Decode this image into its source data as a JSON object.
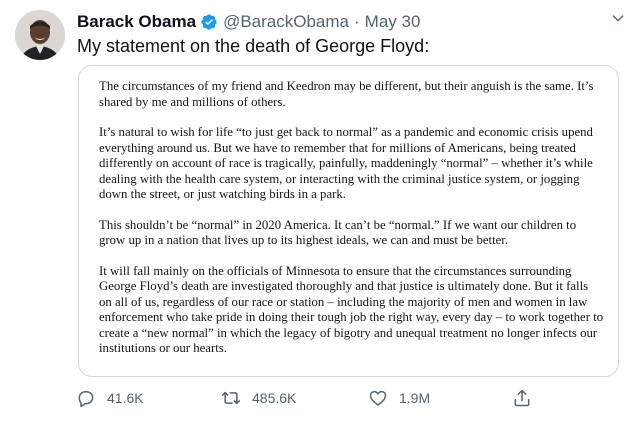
{
  "tweet": {
    "author_name": "Barack Obama",
    "author_handle": "@BarackObama",
    "separator": "·",
    "date": "May 30",
    "text": "My statement on the death of George Floyd:",
    "verified": true
  },
  "statement": {
    "paragraphs": [
      "The circumstances of my friend and Keedron may be different, but their anguish is the same. It’s shared by me and millions of others.",
      "It’s natural to wish for life “to just get back to normal” as a pandemic and economic crisis upend everything around us. But we have to remember that for millions of Americans, being treated differently on account of race is tragically, painfully, maddeningly “normal” – whether it’s while dealing with the health care system, or interacting with the criminal justice system, or jogging down the street, or just watching birds in a park.",
      "This shouldn’t be “normal” in 2020 America. It can’t be “normal.” If we want our children to grow up in a nation that lives up to its highest ideals, we can and must be better.",
      "It will fall mainly on the officials of Minnesota to ensure that the circumstances surrounding George Floyd’s death are investigated thoroughly and that justice is ultimately done. But it falls on all of us, regardless of our race or station – including the majority of men and women in law enforcement who take pride in doing their tough job the right way, every day – to work together to create a “new normal” in which the legacy of bigotry and unequal treatment no longer infects our institutions or our hearts."
    ]
  },
  "actions": {
    "reply_count": "41.6K",
    "retweet_count": "485.6K",
    "like_count": "1.9M"
  },
  "icons": {
    "verified": "verified-badge-icon",
    "more": "chevron-down-icon",
    "reply": "reply-icon",
    "retweet": "retweet-icon",
    "like": "heart-icon",
    "share": "share-icon"
  },
  "colors": {
    "verified_blue": "#1d9bf0",
    "secondary_text": "#536471",
    "border": "#cfd9de"
  }
}
